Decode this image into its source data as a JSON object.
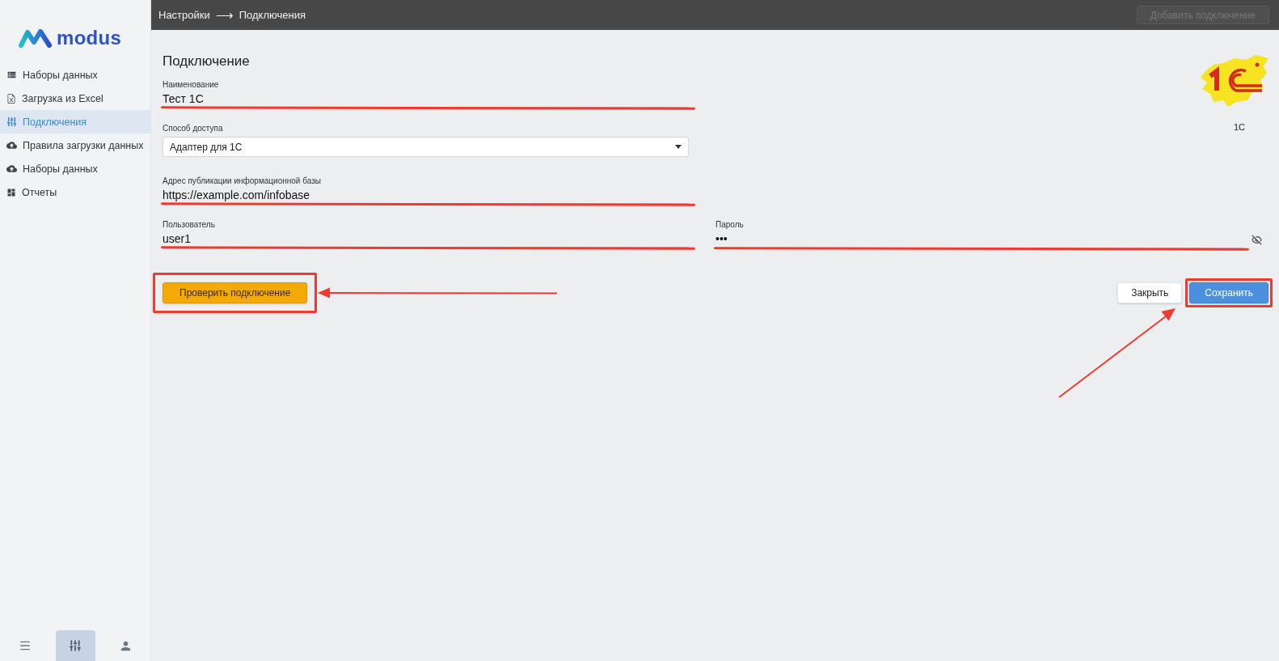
{
  "sidebar": {
    "logo": "modus",
    "items": [
      {
        "label": "Наборы данных",
        "selected": false
      },
      {
        "label": "Загрузка из Excel",
        "selected": false
      },
      {
        "label": "Подключения",
        "selected": true
      },
      {
        "label": "Правила загрузки данных",
        "selected": false
      },
      {
        "label": "Наборы данных",
        "selected": false
      },
      {
        "label": "Отчеты",
        "selected": false
      }
    ],
    "bottom_nav": [
      {
        "selected": false
      },
      {
        "selected": true
      },
      {
        "selected": false
      }
    ]
  },
  "top_bar": {
    "breadcrumb": [
      "Настройки",
      "Подключения"
    ],
    "breadcrumb_separator": "⟶",
    "add_button": {
      "label": "Добавить подключение",
      "disabled": true
    }
  },
  "form": {
    "title": "Подключение",
    "fields": [
      {
        "kind": "text",
        "label": "Наименование",
        "value": "Тест 1С",
        "marked": true
      },
      {
        "kind": "select",
        "label": "Способ доступа",
        "value": "Адаптер для 1С",
        "marked": false
      },
      {
        "kind": "text",
        "label": "Адрес публикации информационной базы",
        "value": "https://example.com/infobase",
        "marked": true
      },
      {
        "kind": "text",
        "label": "Пользователь",
        "value": "user1",
        "marked": true
      },
      {
        "kind": "password",
        "label": "Пароль",
        "value": "•••",
        "marked": true
      }
    ],
    "connector": {
      "label": "1С"
    }
  },
  "buttons": [
    {
      "kind": "check",
      "label": "Проверить подключение",
      "highlighted": true,
      "arrow": true
    },
    {
      "kind": "close",
      "label": "Закрыть",
      "highlighted": false,
      "arrow": false
    },
    {
      "kind": "save",
      "label": "Сохранить",
      "highlighted": true,
      "arrow": true
    }
  ]
}
